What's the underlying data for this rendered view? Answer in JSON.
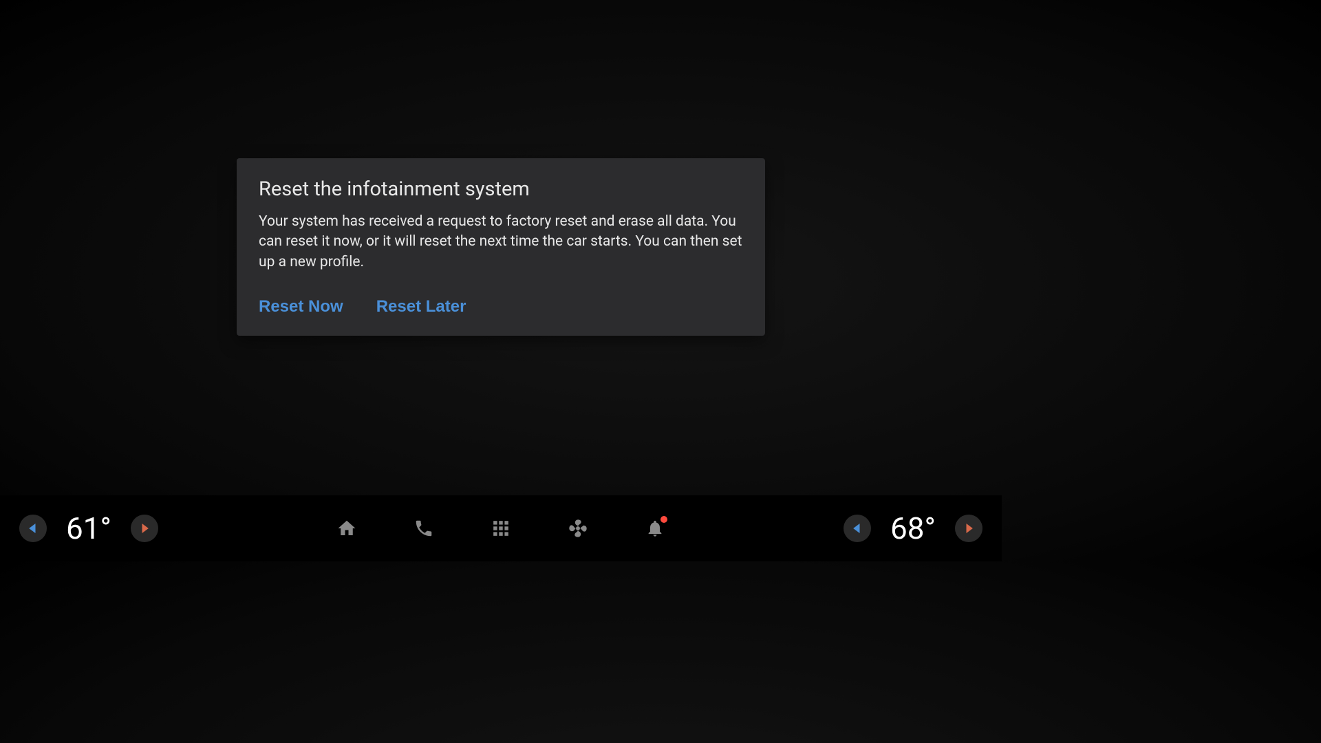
{
  "dialog": {
    "title": "Reset the infotainment system",
    "body": "Your system has received a request to factory reset and erase all data. You can reset it now, or it will reset the next time the car starts. You can then set up a new profile.",
    "reset_now_label": "Reset Now",
    "reset_later_label": "Reset Later"
  },
  "bottom_bar": {
    "left_temp": "61°",
    "right_temp": "68°"
  },
  "colors": {
    "accent": "#4a90d9",
    "arrow_blue": "#4a90d9",
    "arrow_red": "#d9694a",
    "notification": "#ff4a3d"
  }
}
